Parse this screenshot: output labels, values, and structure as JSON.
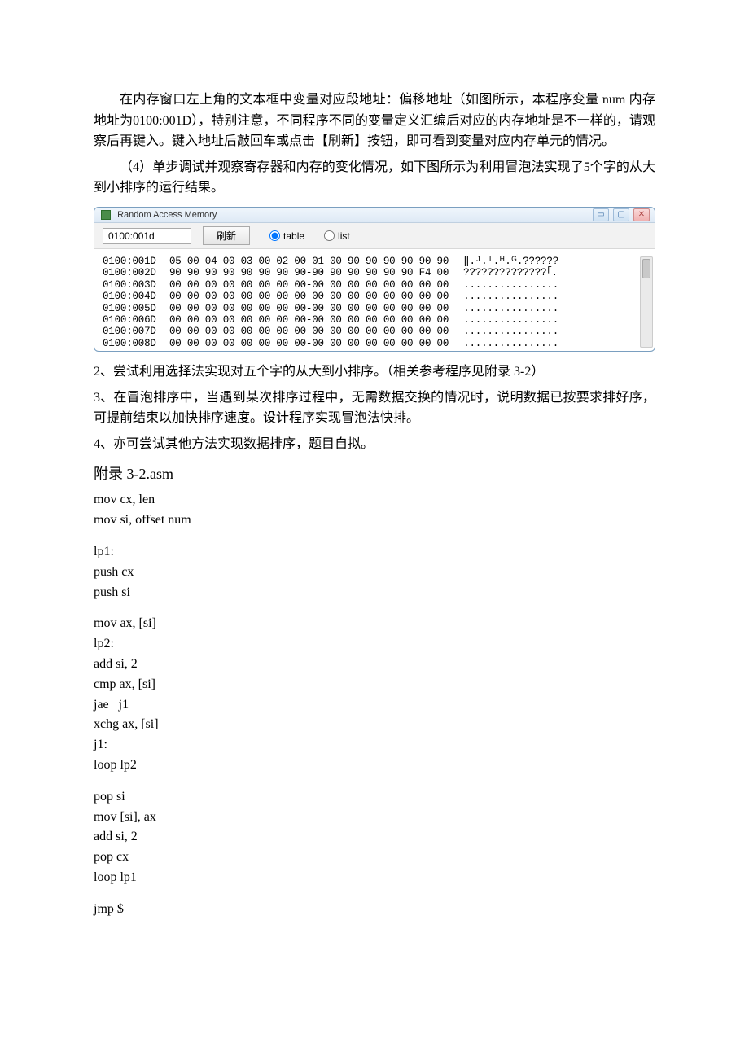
{
  "text": {
    "p1": "在内存窗口左上角的文本框中变量对应段地址：偏移地址（如图所示，本程序变量 num 内存地址为0100:001D），特别注意，不同程序不同的变量定义汇编后对应的内存地址是不一样的，请观察后再键入。键入地址后敲回车或点击【刷新】按钮，即可看到变量对应内存单元的情况。",
    "p2": "（4）单步调试并观察寄存器和内存的变化情况，如下图所示为利用冒泡法实现了5个字的从大到小排序的运行结果。",
    "p3": "2、尝试利用选择法实现对五个字的从大到小排序。（相关参考程序见附录 3-2）",
    "p4": "3、在冒泡排序中，当遇到某次排序过程中，无需数据交换的情况时，说明数据已按要求排好序，可提前结束以加快排序速度。设计程序实现冒泡法快排。",
    "p5": "4、亦可尝试其他方法实现数据排序，题目自拟。",
    "appendix_title": "附录 3-2.asm"
  },
  "memory": {
    "title": "Random Access Memory",
    "input_value": "0100:001d",
    "refresh_label": "刷新",
    "radio_table": "table",
    "radio_list": "list",
    "addrs": "0100:001D\n0100:002D\n0100:003D\n0100:004D\n0100:005D\n0100:006D\n0100:007D\n0100:008D",
    "bytes": "05 00 04 00 03 00 02 00-01 00 90 90 90 90 90 90\n90 90 90 90 90 90 90 90-90 90 90 90 90 90 F4 00\n00 00 00 00 00 00 00 00-00 00 00 00 00 00 00 00\n00 00 00 00 00 00 00 00-00 00 00 00 00 00 00 00\n00 00 00 00 00 00 00 00-00 00 00 00 00 00 00 00\n00 00 00 00 00 00 00 00-00 00 00 00 00 00 00 00\n00 00 00 00 00 00 00 00-00 00 00 00 00 00 00 00\n00 00 00 00 00 00 00 00-00 00 00 00 00 00 00 00",
    "ascii": "‖.ᴶ.ᴵ.ᴴ.ᴳ.??????\n??????????????｢.\n................\n................\n................\n................\n................\n................"
  },
  "code": {
    "block1": "mov cx, len\nmov si, offset num",
    "block2": "lp1:\npush cx\npush si",
    "block3": "mov ax, [si]\nlp2:\nadd si, 2\ncmp ax, [si]\njae   j1\nxchg ax, [si]\nj1:\nloop lp2",
    "block4": "pop si\nmov [si], ax\nadd si, 2\npop cx\nloop lp1",
    "block5": "jmp $"
  }
}
